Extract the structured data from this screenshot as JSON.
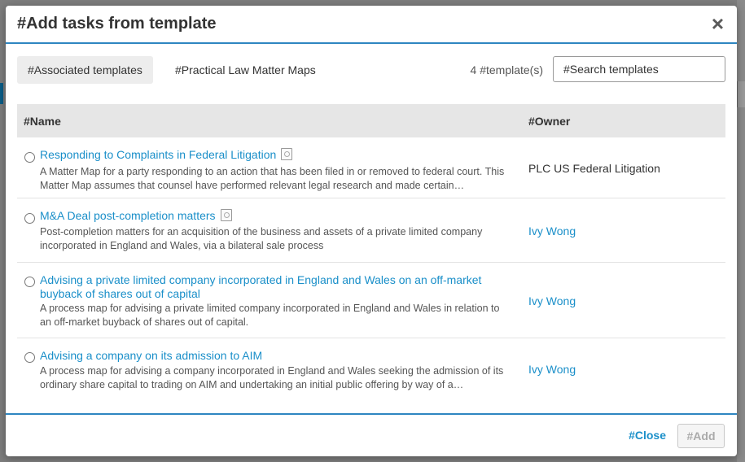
{
  "dialog": {
    "title": "#Add tasks from template",
    "close_icon": "×"
  },
  "tabs": [
    {
      "label": "#Associated templates",
      "active": true
    },
    {
      "label": "#Practical Law Matter Maps",
      "active": false
    }
  ],
  "template_count": "4 #template(s)",
  "search": {
    "placeholder": "#Search templates",
    "value": ""
  },
  "table": {
    "columns": [
      "#Name",
      "#Owner"
    ],
    "rows": [
      {
        "title": "Responding to Complaints in Federal Litigation",
        "has_map_icon": true,
        "description": "A Matter Map for a party responding to an action that has been filed in or removed to federal court. This Matter Map assumes that counsel have performed relevant legal research and made certain…",
        "owner": "PLC US Federal Litigation",
        "owner_is_link": false
      },
      {
        "title": "M&A Deal post-completion matters",
        "has_map_icon": true,
        "description": "Post-completion matters for an acquisition of the business and assets of a private limited company incorporated in England and Wales, via a bilateral sale process",
        "owner": "Ivy Wong",
        "owner_is_link": true
      },
      {
        "title": "Advising a private limited company incorporated in England and Wales on an off-market buyback of shares out of capital",
        "has_map_icon": false,
        "description": "A process map for advising a private limited company incorporated in England and Wales in relation to an off-market buyback of shares out of capital.",
        "owner": "Ivy Wong",
        "owner_is_link": true
      },
      {
        "title": "Advising a company on its admission to AIM",
        "has_map_icon": false,
        "description": "A process map for advising a company incorporated in England and Wales seeking the admission of its ordinary share capital to trading on AIM and undertaking an initial public offering by way of a…",
        "owner": "Ivy Wong",
        "owner_is_link": true
      }
    ]
  },
  "footer": {
    "close_label": "#Close",
    "add_label": "#Add"
  },
  "colors": {
    "accent": "#2e86c1",
    "link": "#1a8fc9",
    "header_bg": "#e6e6e6",
    "overlay": "#7d7d7d"
  }
}
